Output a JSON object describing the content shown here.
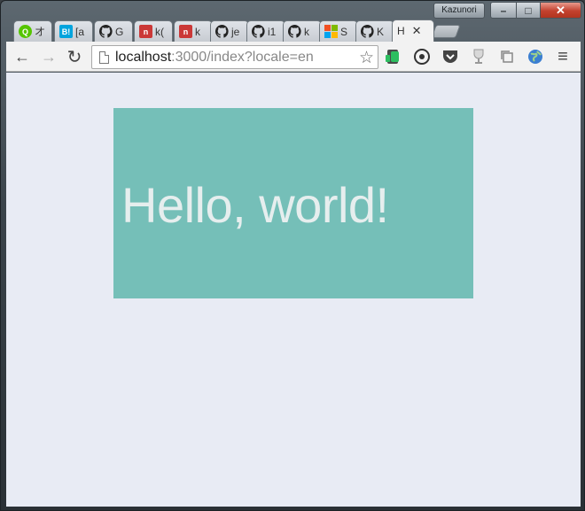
{
  "window": {
    "profile_name": "Kazunori",
    "controls": {
      "minimize": "–",
      "maximize": "□",
      "close": "✕"
    }
  },
  "tabs": [
    {
      "title": "オ",
      "icon": "qiita-icon",
      "color": "#55c500",
      "glyph": "Q"
    },
    {
      "title": "[a",
      "icon": "hatena-bookmark-icon",
      "color": "#00a4de",
      "glyph": "B!"
    },
    {
      "title": "G",
      "icon": "github-icon",
      "color": "#222222",
      "glyph": ""
    },
    {
      "title": "k(",
      "icon": "npm-icon",
      "color": "#cb3837",
      "glyph": "n"
    },
    {
      "title": "k",
      "icon": "npm-icon",
      "color": "#cb3837",
      "glyph": "n"
    },
    {
      "title": "je",
      "icon": "github-icon",
      "color": "#222222",
      "glyph": ""
    },
    {
      "title": "i1",
      "icon": "github-icon",
      "color": "#222222",
      "glyph": ""
    },
    {
      "title": "k",
      "icon": "github-icon",
      "color": "#222222",
      "glyph": ""
    },
    {
      "title": "S",
      "icon": "microsoft-icon",
      "color": "#f25022",
      "glyph": ""
    },
    {
      "title": "K",
      "icon": "github-icon",
      "color": "#222222",
      "glyph": ""
    },
    {
      "title": "H",
      "icon": "",
      "color": "",
      "glyph": "",
      "active": true,
      "close": "✕"
    }
  ],
  "toolbar": {
    "back": "←",
    "forward": "→",
    "reload": "↻",
    "url_host": "localhost",
    "url_rest": ":3000/index?locale=en",
    "bookmark_star": "☆",
    "extensions": [
      "evernote-icon",
      "record-icon",
      "pocket-icon",
      "trophy-icon",
      "copy-icon",
      "globe-icon"
    ],
    "menu": "≡"
  },
  "page": {
    "heading": "Hello, world!",
    "box_color": "#75bfb8",
    "background": "#e8ebf4"
  }
}
